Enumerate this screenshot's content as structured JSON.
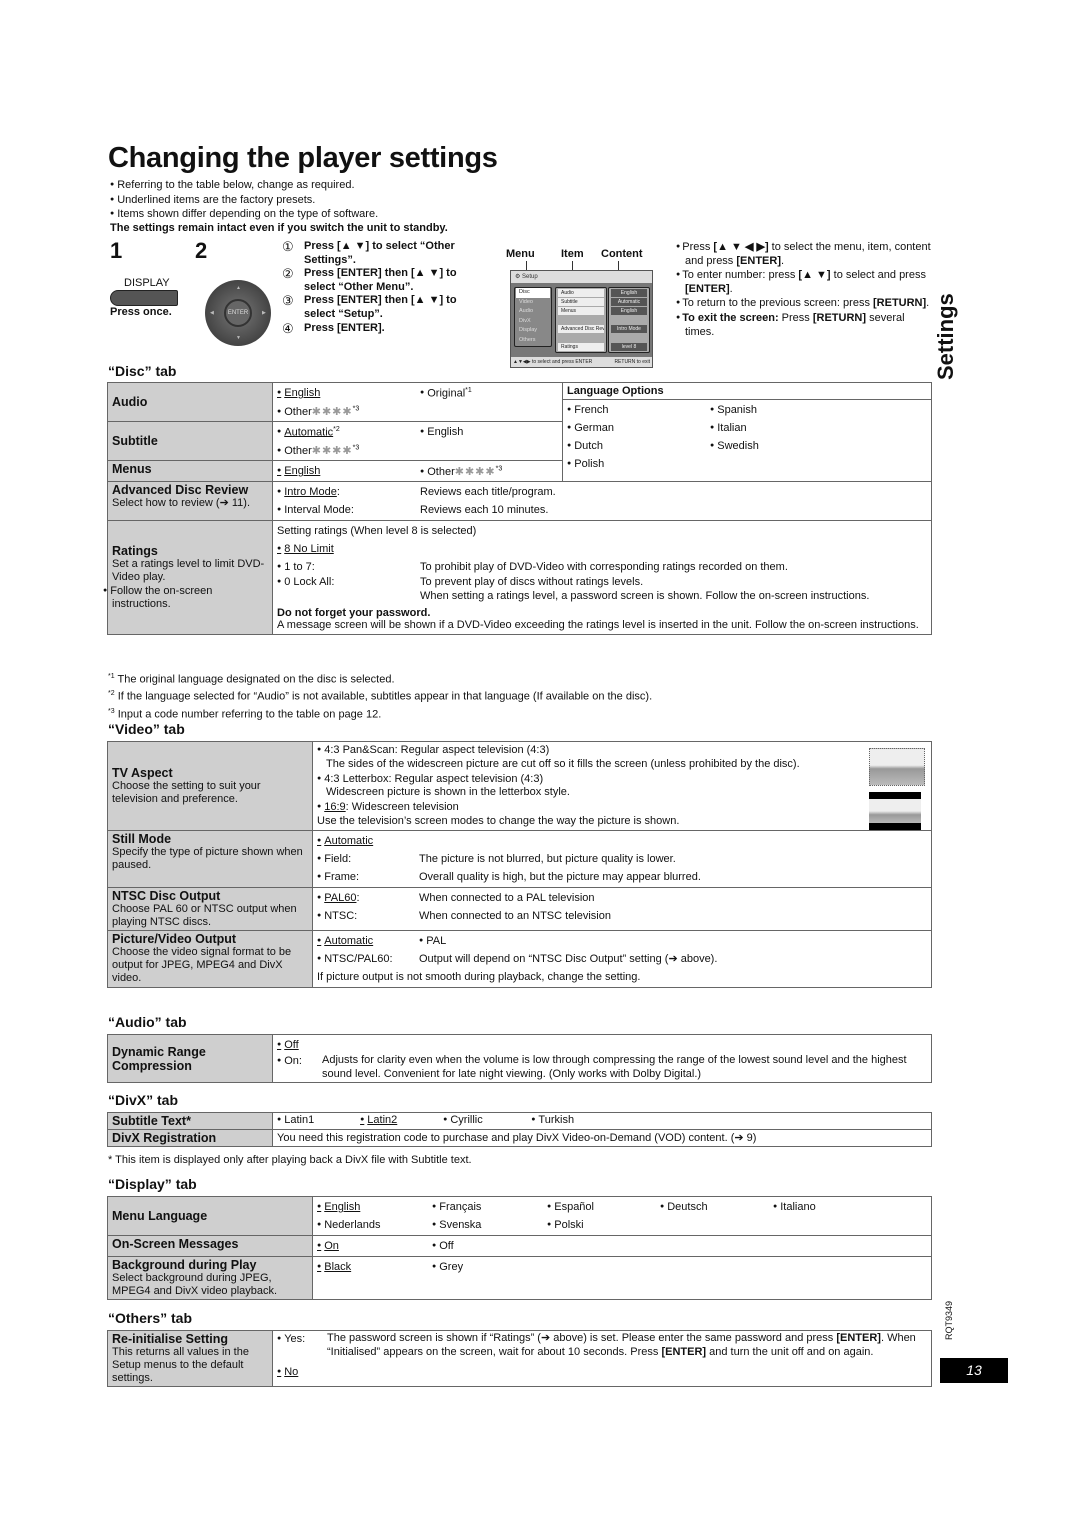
{
  "page": {
    "title": "Changing the player settings",
    "intro": [
      "Referring to the table below, change as required.",
      "Underlined items are the factory presets.",
      "Items shown differ depending on the type of software."
    ],
    "intro_bold": "The settings remain intact even if you switch the unit to standby.",
    "side_label": "Settings",
    "doc_code": "RQT9349",
    "page_number": "13"
  },
  "steps": {
    "step1_num": "1",
    "step2_num": "2",
    "display_label": "DISPLAY",
    "press_once": "Press once.",
    "enter_label": "ENTER",
    "items": [
      {
        "num": "①",
        "text": "Press [▲ ▼] to select “Other Settings”."
      },
      {
        "num": "②",
        "text": "Press [ENTER] then [▲ ▼] to select “Other Menu”."
      },
      {
        "num": "③",
        "text": "Press [ENTER] then [▲ ▼] to select “Setup”."
      },
      {
        "num": "④",
        "text": "Press [ENTER]."
      }
    ]
  },
  "osd": {
    "col_headers": [
      "Menu",
      "Item",
      "Content"
    ],
    "title": "Setup",
    "menu": [
      "Disc",
      "Video",
      "Audio",
      "DivX",
      "Display",
      "Others"
    ],
    "items": [
      "Audio",
      "Subtitle",
      "Menus",
      "",
      "Advanced Disc Review",
      "",
      "Ratings"
    ],
    "content": [
      "English",
      "Automatic",
      "English",
      "",
      "Intro Mode",
      "",
      "level 8"
    ],
    "footer_left": "▲▼◀▶ to select and press ENTER",
    "footer_right": "RETURN to exit"
  },
  "instructions": [
    {
      "pre": "Press ",
      "b1": "[▲ ▼ ◀ ▶]",
      "mid": " to select the menu, item, content and press ",
      "b2": "[ENTER]",
      "post": "."
    },
    {
      "pre": "To enter number: press ",
      "b1": "[▲ ▼]",
      "mid": " to select and press ",
      "b2": "[ENTER]",
      "post": "."
    },
    {
      "pre": "To return to the previous screen: press ",
      "b1": "[RETURN]",
      "mid": ".",
      "b2": "",
      "post": ""
    },
    {
      "pre": "",
      "b1": "To exit the screen:",
      "mid": " Press ",
      "b2": "[RETURN]",
      "post": " several times."
    }
  ],
  "disc_tab": {
    "heading": "“Disc” tab",
    "audio": {
      "label": "Audio",
      "opt1": "English",
      "opt2": "Original",
      "opt2_sup": "*1",
      "opt3": "Other",
      "stars": "✱✱✱✱",
      "sup3": "*3"
    },
    "subtitle": {
      "label": "Subtitle",
      "opt1": "Automatic",
      "opt1_sup": "*2",
      "opt2": "English",
      "opt3": "Other",
      "stars": "✱✱✱✱",
      "sup3": "*3"
    },
    "menus": {
      "label": "Menus",
      "opt1": "English",
      "opt2": "Other",
      "stars": "✱✱✱✱",
      "sup2": "*3"
    },
    "language_options": {
      "header": "Language Options",
      "items": [
        "French",
        "Spanish",
        "German",
        "Italian",
        "Dutch",
        "Swedish",
        "Polish"
      ]
    },
    "adr": {
      "label": "Advanced Disc Review",
      "sub": "Select how to review (➔ 11).",
      "opt1": "Intro Mode",
      "opt1_colon": ":",
      "desc1": "Reviews each title/program.",
      "opt2": "Interval Mode:",
      "desc2": "Reviews each 10 minutes."
    },
    "ratings": {
      "label": "Ratings",
      "sub1": "Set a ratings level to limit DVD-Video play.",
      "sub2": "Follow the on-screen instructions.",
      "intro": "Setting ratings (When level 8 is selected)",
      "opt1": "8 No Limit",
      "opt2": "1 to 7:",
      "desc2": "To prohibit play of DVD-Video with corresponding ratings recorded on them.",
      "opt3": "0 Lock All:",
      "desc3a": "To prevent play of discs without ratings levels.",
      "desc3b": "When setting a ratings level, a password screen is shown. Follow the on-screen instructions.",
      "warn_bold": "Do not forget your password.",
      "warn": "A message screen will be shown if a DVD-Video exceeding the ratings level is inserted in the unit. Follow the on-screen instructions."
    },
    "footnotes": [
      {
        "mark": "*1",
        "text": "The original language designated on the disc is selected."
      },
      {
        "mark": "*2",
        "text": "If the language selected for “Audio” is not available, subtitles appear in that language (If available on the disc)."
      },
      {
        "mark": "*3",
        "text": "Input a code number referring to the table on page 12."
      }
    ]
  },
  "video_tab": {
    "heading": "“Video” tab",
    "tv_aspect": {
      "label": "TV Aspect",
      "sub": "Choose the setting to suit your television and preference.",
      "l1": "4:3 Pan&Scan: Regular aspect television (4:3)",
      "l2": "The sides of the widescreen picture are cut off so it fills the screen (unless prohibited by the disc).",
      "l3": "4:3 Letterbox: Regular aspect television (4:3)",
      "l4": "Widescreen picture is shown in the letterbox style.",
      "l5_u": "16:9",
      "l5": ": Widescreen television",
      "l6": "Use the television’s screen modes to change the way the picture is shown."
    },
    "still_mode": {
      "label": "Still Mode",
      "sub": "Specify the type of picture shown when paused.",
      "opt1": "Automatic",
      "opt2": "Field:",
      "desc2": "The picture is not blurred, but picture quality is lower.",
      "opt3": "Frame:",
      "desc3": "Overall quality is high, but the picture may appear blurred."
    },
    "ntsc": {
      "label": "NTSC Disc Output",
      "sub": "Choose PAL 60 or NTSC output when playing NTSC discs.",
      "opt1": "PAL60",
      "desc1": "When connected to a PAL television",
      "opt2": "NTSC:",
      "desc2": "When connected to an NTSC television"
    },
    "pvo": {
      "label": "Picture/Video Output",
      "sub": "Choose the video signal format to be output for JPEG, MPEG4 and DivX video.",
      "opt1": "Automatic",
      "opt2": "PAL",
      "opt3": "NTSC/PAL60:",
      "desc3": "Output will depend on “NTSC Disc Output” setting (➔ above).",
      "note": "If picture output is not smooth during playback, change the setting."
    }
  },
  "audio_tab": {
    "heading": "“Audio” tab",
    "drc": {
      "label": "Dynamic Range Compression",
      "opt1": "Off",
      "opt2": "On:",
      "desc2": "Adjusts for clarity even when the volume is low through compressing the range of the lowest sound level and the highest sound level. Convenient for late night viewing. (Only works with Dolby Digital.)"
    }
  },
  "divx_tab": {
    "heading": "“DivX” tab",
    "subtitle_text": {
      "label": "Subtitle Text*",
      "opts": [
        "Latin1",
        "Latin2",
        "Cyrillic",
        "Turkish"
      ]
    },
    "registration": {
      "label": "DivX Registration",
      "desc": "You need this registration code to purchase and play DivX Video-on-Demand (VOD) content. (➔ 9)"
    },
    "footnote": "* This item is displayed only after playing back a DivX file with Subtitle text."
  },
  "display_tab": {
    "heading": "“Display” tab",
    "menu_language": {
      "label": "Menu Language",
      "opts": [
        "English",
        "Français",
        "Español",
        "Deutsch",
        "Italiano",
        "Nederlands",
        "Svenska",
        "Polski"
      ]
    },
    "osm": {
      "label": "On-Screen Messages",
      "opt1": "On",
      "opt2": "Off"
    },
    "bg": {
      "label": "Background during Play",
      "sub": "Select background during JPEG, MPEG4 and DivX video playback.",
      "opt1": "Black",
      "opt2": "Grey"
    }
  },
  "others_tab": {
    "heading": "“Others” tab",
    "reinit": {
      "label": "Re-initialise Setting",
      "sub": "This returns all values in the Setup menus to the default settings.",
      "opt1": "Yes:",
      "d1": "The password screen is shown if “Ratings” (➔ above) is set. Please enter the same password and press ",
      "b1": "[ENTER]",
      "d2": ". When “Initialised” appears on the screen, wait for about 10 seconds. Press ",
      "b2": "[ENTER]",
      "d3": " and turn the unit off and on again.",
      "opt2": "No"
    }
  }
}
